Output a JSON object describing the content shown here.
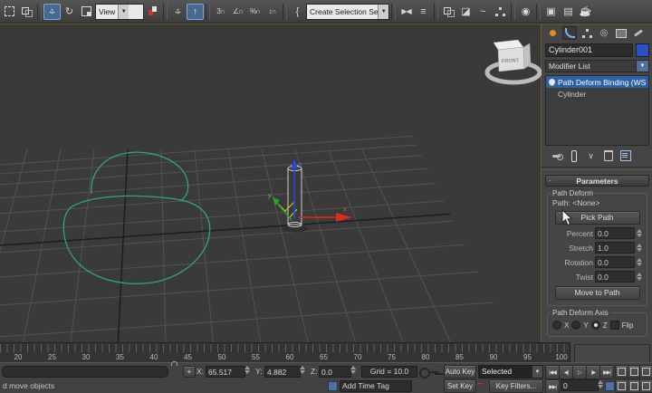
{
  "toolbar": {
    "coordinate_system": "View",
    "selection_set": "Create Selection Se",
    "dropdown_arrow": "▼"
  },
  "viewport": {
    "viewcube_label": "FRONT",
    "axis_x": "x",
    "axis_y": "y",
    "axis_z": "z"
  },
  "command_panel": {
    "object_name": "Cylinder001",
    "modifier_list": "Modifier List",
    "stack": [
      {
        "label": "Path Deform Binding (WS"
      },
      {
        "label": "Cylinder"
      }
    ],
    "parameters": {
      "header": "Parameters",
      "collapse_glyph": "-",
      "group": "Path Deform",
      "path_label": "Path:",
      "path_value": "<None>",
      "pick_path": "Pick Path",
      "spinners": [
        {
          "label": "Percent",
          "value": "0.0"
        },
        {
          "label": "Stretch",
          "value": "1.0"
        },
        {
          "label": "Rotation",
          "value": "0.0"
        },
        {
          "label": "Twist",
          "value": "0.0"
        }
      ],
      "move_to_path": "Move to Path",
      "axis_group": "Path Deform Axis",
      "axis_x": "X",
      "axis_y": "Y",
      "axis_z": "Z",
      "axis_selected": "Z",
      "flip": "Flip"
    }
  },
  "timeline": {
    "labels": [
      "20",
      "25",
      "30",
      "35",
      "40",
      "45",
      "50",
      "55",
      "60",
      "65",
      "70",
      "75",
      "80",
      "85",
      "90",
      "95",
      "100"
    ]
  },
  "status_bar": {
    "prompt": "d move objects",
    "x_label": "X:",
    "x_value": "65.517",
    "y_label": "Y:",
    "y_value": "4.882",
    "z_label": "Z:",
    "z_value": "0.0",
    "grid": "Grid = 10.0",
    "add_time_tag": "Add Time Tag",
    "auto_key": "Auto Key",
    "set_key": "Set Key",
    "selection_filter": "Selected",
    "key_filters": "Key Filters...",
    "frame": "0"
  },
  "colors": {
    "selection_blue": "#2d61a3",
    "spline_teal": "#34a08b",
    "axis_red": "#d92b1e",
    "axis_green": "#27a327",
    "axis_blue": "#2b45e0",
    "viewport_border": "#6d5a27",
    "object_color": "#2b50c8"
  }
}
